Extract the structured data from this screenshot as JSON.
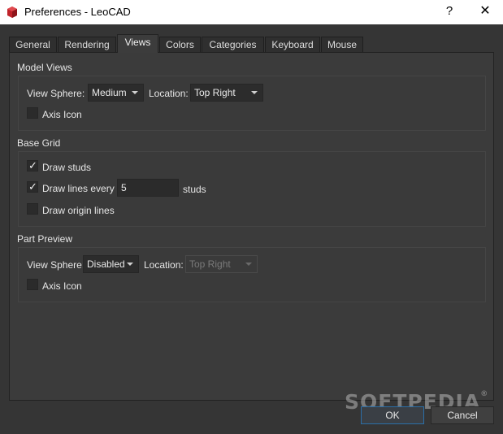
{
  "window": {
    "title": "Preferences - LeoCAD",
    "help_glyph": "?",
    "close_glyph": "✕"
  },
  "tabs": [
    {
      "label": "General"
    },
    {
      "label": "Rendering"
    },
    {
      "label": "Views"
    },
    {
      "label": "Colors"
    },
    {
      "label": "Categories"
    },
    {
      "label": "Keyboard"
    },
    {
      "label": "Mouse"
    }
  ],
  "active_tab": "Views",
  "model_views": {
    "title": "Model Views",
    "view_sphere_label": "View Sphere:",
    "view_sphere_value": "Medium",
    "location_label": "Location:",
    "location_value": "Top Right",
    "axis_icon_label": "Axis Icon",
    "axis_icon_checked": false
  },
  "base_grid": {
    "title": "Base Grid",
    "draw_studs_label": "Draw studs",
    "draw_studs_checked": true,
    "draw_lines_label": "Draw lines every",
    "draw_lines_checked": true,
    "lines_value": "5",
    "studs_unit": "studs",
    "draw_origin_label": "Draw origin lines",
    "draw_origin_checked": false,
    "check_glyph": "✓"
  },
  "part_preview": {
    "title": "Part Preview",
    "view_sphere_label": "View Sphere:",
    "view_sphere_value": "Disabled",
    "location_label": "Location:",
    "location_value": "Top Right",
    "axis_icon_label": "Axis Icon",
    "axis_icon_checked": false
  },
  "buttons": {
    "ok": "OK",
    "cancel": "Cancel"
  },
  "watermark": {
    "text": "SOFTPEDIA",
    "mark": "®"
  },
  "colors": {
    "background": "#353535",
    "panel": "#3b3b3b",
    "accent": "#2b6fa8",
    "app_icon": "#c0232a"
  }
}
